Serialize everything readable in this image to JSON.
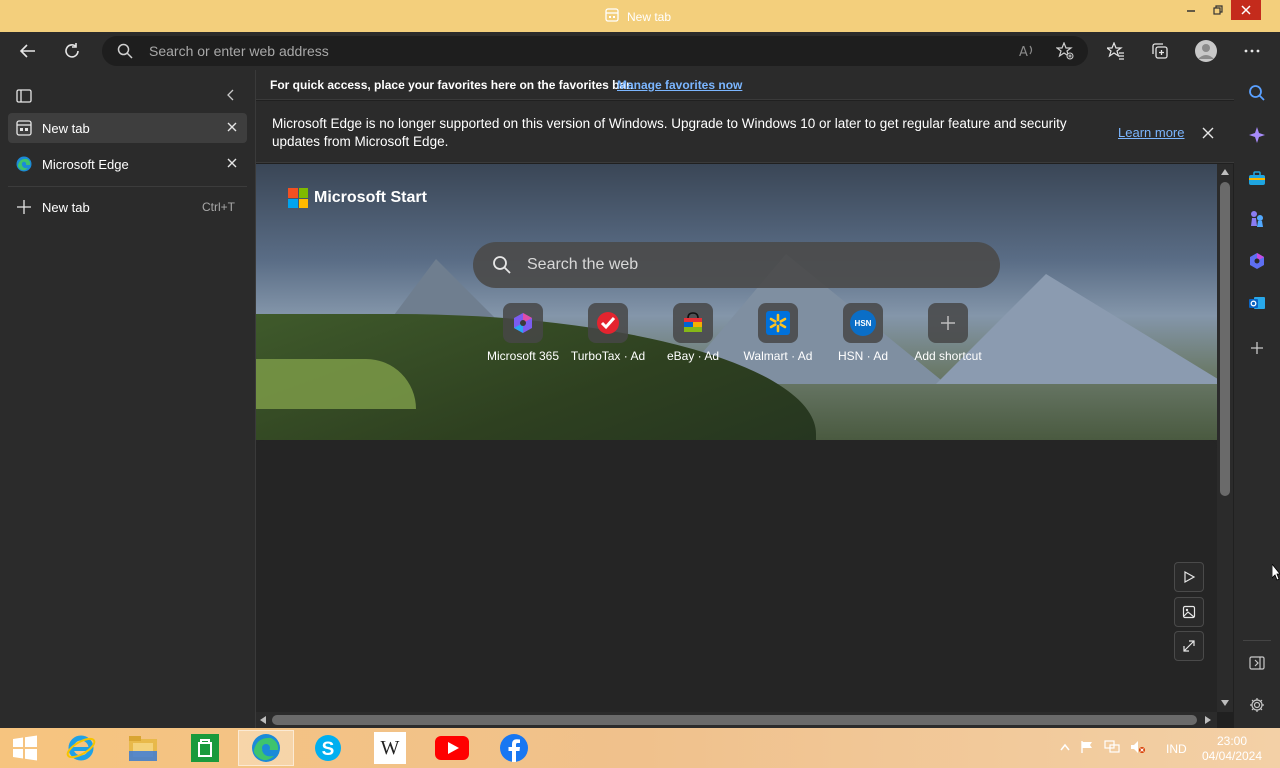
{
  "window": {
    "title": "New tab"
  },
  "toolbar": {
    "address_placeholder": "Search or enter web address"
  },
  "vertical_tabs": {
    "tabs": [
      {
        "label": "New tab"
      },
      {
        "label": "Microsoft Edge"
      }
    ],
    "new_tab": {
      "label": "New tab",
      "shortcut": "Ctrl+T"
    }
  },
  "favorites_bar": {
    "text": "For quick access, place your favorites here on the favorites bar.",
    "link": "Manage favorites now"
  },
  "infobar": {
    "message": "Microsoft Edge is no longer supported on this version of Windows. Upgrade to Windows 10 or later to get regular feature and security updates from Microsoft Edge.",
    "learn_more": "Learn more"
  },
  "newtab_page": {
    "brand": "Microsoft Start",
    "search_placeholder": "Search the web",
    "shortcuts": [
      {
        "label": "Microsoft 365",
        "icon": "microsoft-365-icon"
      },
      {
        "label": "TurboTax · Ad",
        "icon": "turbotax-icon"
      },
      {
        "label": "eBay · Ad",
        "icon": "ebay-icon"
      },
      {
        "label": "Walmart · Ad",
        "icon": "walmart-icon"
      },
      {
        "label": "HSN · Ad",
        "icon": "hsn-icon",
        "icon_text": "HSN"
      },
      {
        "label": "Add shortcut",
        "icon": "plus-icon"
      }
    ]
  },
  "taskbar": {
    "language": "IND",
    "time": "23:00",
    "date": "04/04/2024",
    "apps": [
      "start",
      "internet-explorer",
      "file-explorer",
      "store",
      "edge",
      "skype",
      "wikipedia",
      "youtube",
      "facebook"
    ],
    "wikipedia_glyph": "W"
  },
  "colors": {
    "titlebar": "#f3cf7c",
    "close_button": "#c42b1c",
    "link": "#7bb6ff",
    "panel": "#2b2b2b"
  }
}
